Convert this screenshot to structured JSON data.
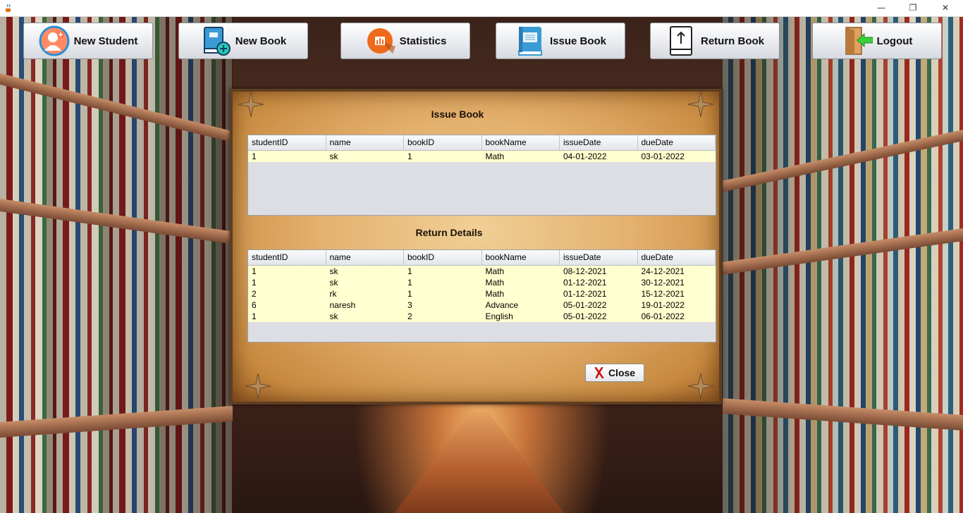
{
  "window": {
    "minimize": "—",
    "maximize": "❐",
    "close": "✕"
  },
  "toolbar": [
    {
      "label": "New Student",
      "icon": "student-avatar-add-icon"
    },
    {
      "label": "New Book",
      "icon": "book-add-icon"
    },
    {
      "label": "Statistics",
      "icon": "bar-chart-icon"
    },
    {
      "label": "Issue Book",
      "icon": "blue-book-icon"
    },
    {
      "label": "Return Book",
      "icon": "book-return-arrow-icon"
    },
    {
      "label": "Logout",
      "icon": "door-exit-arrow-icon"
    }
  ],
  "issue_section": {
    "title": "Issue Book",
    "columns": [
      "studentID",
      "name",
      "bookID",
      "bookName",
      "issueDate",
      "dueDate"
    ],
    "rows": [
      [
        "1",
        "sk",
        "1",
        "Math",
        "04-01-2022",
        "03-01-2022"
      ]
    ]
  },
  "return_section": {
    "title": "Return Details",
    "columns": [
      "studentID",
      "name",
      "bookID",
      "bookName",
      "issueDate",
      "dueDate"
    ],
    "rows": [
      [
        "1",
        "sk",
        "1",
        "Math",
        "08-12-2021",
        "24-12-2021"
      ],
      [
        "1",
        "sk",
        "1",
        "Math",
        "01-12-2021",
        "30-12-2021"
      ],
      [
        "2",
        "rk",
        "1",
        "Math",
        "01-12-2021",
        "15-12-2021"
      ],
      [
        "6",
        "naresh",
        "3",
        "Advance",
        "05-01-2022",
        "19-01-2022"
      ],
      [
        "1",
        "sk",
        "2",
        "English",
        "05-01-2022",
        "06-01-2022"
      ]
    ]
  },
  "close_button": {
    "label": "Close",
    "icon": "red-x-icon"
  },
  "colors": {
    "row_highlight": "#ffffcf",
    "parchment": "#e4b16e",
    "table_bg": "#dcdee3"
  }
}
